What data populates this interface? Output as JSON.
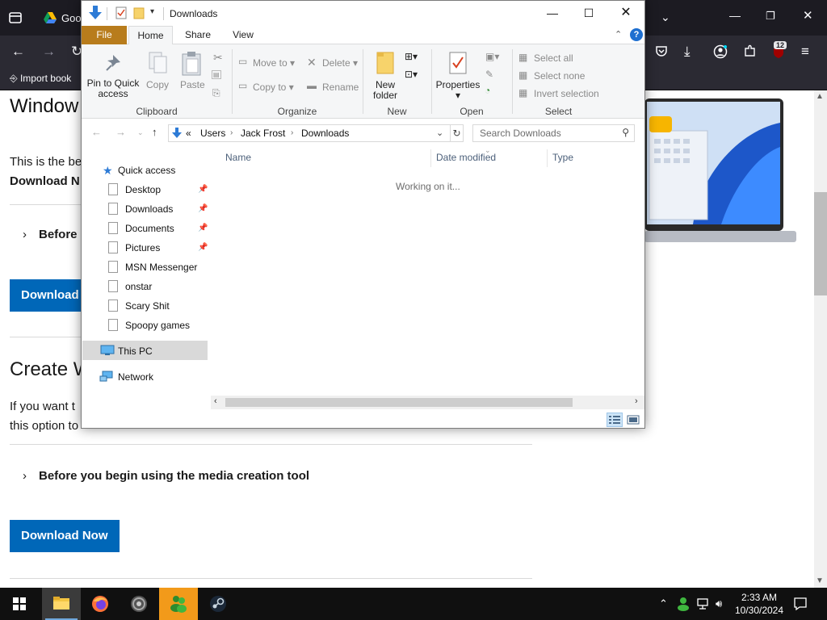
{
  "browser": {
    "tab_title": "Goo",
    "bookmark_label": "Import book",
    "notification_count": "12"
  },
  "page": {
    "heading1": "Window",
    "paragraph1_line1": "This is the be",
    "paragraph1_line2": "Download N",
    "expander1": "Before",
    "download_button_1": "Download",
    "heading2": "Create W",
    "paragraph2_line1": "If you want t",
    "paragraph2_line2": "this option to",
    "expander2": "Before you begin using the media creation tool",
    "download_button_2": "Download Now"
  },
  "explorer": {
    "window_title": "Downloads",
    "ribbon_tabs": [
      "File",
      "Home",
      "Share",
      "View"
    ],
    "ribbon": {
      "pin_to_quick_access_line1": "Pin to Quick",
      "pin_to_quick_access_line2": "access",
      "copy": "Copy",
      "paste": "Paste",
      "move_to": "Move to",
      "copy_to": "Copy to",
      "delete": "Delete",
      "rename": "Rename",
      "new_folder_line1": "New",
      "new_folder_line2": "folder",
      "properties": "Properties",
      "select_all": "Select all",
      "select_none": "Select none",
      "invert_selection": "Invert selection",
      "groups": [
        "Clipboard",
        "Organize",
        "New",
        "Open",
        "Select"
      ]
    },
    "address": {
      "prefix": "«",
      "segments": [
        "Users",
        "Jack Frost",
        "Downloads"
      ],
      "search_placeholder": "Search Downloads"
    },
    "nav": {
      "quick_access": "Quick access",
      "items": [
        "Desktop",
        "Downloads",
        "Documents",
        "Pictures",
        "MSN Messenger",
        "onstar",
        "Scary Shit",
        "Spoopy games"
      ],
      "this_pc": "This PC",
      "network": "Network"
    },
    "columns": [
      "Name",
      "Date modified",
      "Type"
    ],
    "status_message": "Working on it..."
  },
  "taskbar": {
    "time": "2:33 AM",
    "date": "10/30/2024"
  },
  "colors": {
    "file_tab": "#b87c1c",
    "download_button": "#0067b8",
    "browser_chrome": "#2b2a33",
    "taskbar": "#101010"
  }
}
